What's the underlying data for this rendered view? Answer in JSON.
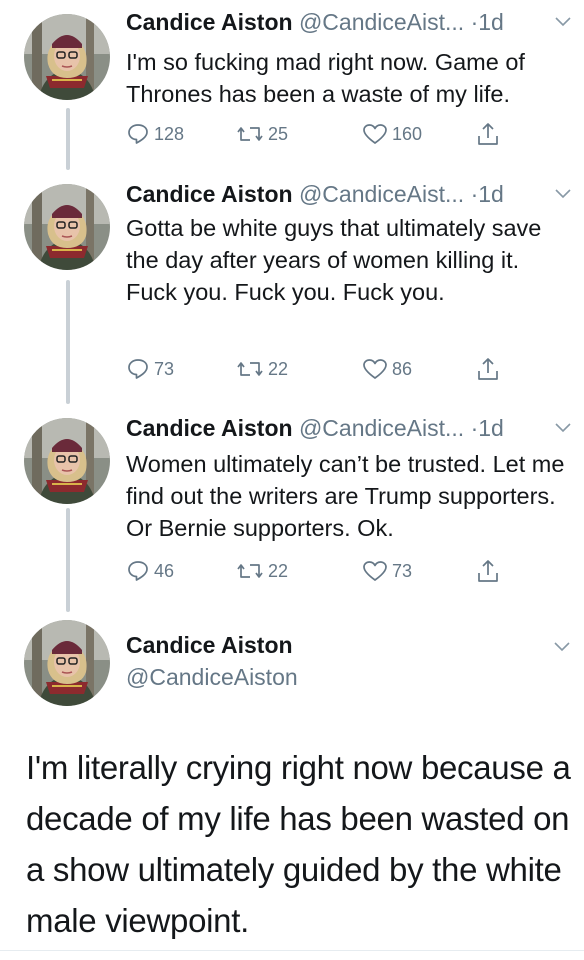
{
  "user": {
    "name": "Candice Aiston",
    "handle_truncated_1": "@CandiceAist...",
    "handle_truncated_2": "@CandiceAist...",
    "handle_truncated_3": "@CandiceAist...",
    "handle_full": "@CandiceAiston",
    "separator": "·",
    "time": "1d"
  },
  "tweets": [
    {
      "text": "I'm so fucking mad right now. Game of Thrones has been a waste of my life.",
      "replies": "128",
      "retweets": "25",
      "likes": "160"
    },
    {
      "text": "Gotta be white guys that ultimately save the day after years of women killing it. Fuck you. Fuck you. Fuck you.",
      "replies": "73",
      "retweets": "22",
      "likes": "86"
    },
    {
      "text": "Women ultimately can’t be trusted. Let me find out the writers are Trump supporters. Or Bernie supporters. Ok.",
      "replies": "46",
      "retweets": "22",
      "likes": "73"
    }
  ],
  "main_tweet": {
    "text": "I'm literally crying right now because a decade of my life has been wasted on a show ultimately guided by the white male viewpoint."
  },
  "colors": {
    "text": "#14171a",
    "secondary": "#657786",
    "thread_line": "#c9d0d6"
  },
  "icons": [
    "reply-icon",
    "retweet-icon",
    "like-icon",
    "share-icon",
    "chevron-down-icon"
  ]
}
